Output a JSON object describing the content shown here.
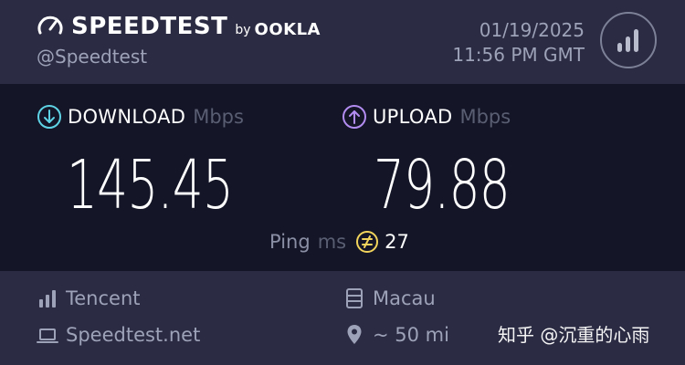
{
  "header": {
    "brand": "SPEEDTEST",
    "by": "by",
    "provider": "OOKLA",
    "handle": "@Speedtest",
    "date": "01/19/2025",
    "time": "11:56 PM GMT"
  },
  "results": {
    "download": {
      "label": "DOWNLOAD",
      "unit": "Mbps",
      "value": "145.45"
    },
    "upload": {
      "label": "UPLOAD",
      "unit": "Mbps",
      "value": "79.88"
    },
    "ping": {
      "label": "Ping",
      "unit": "ms",
      "value": "27"
    }
  },
  "server": {
    "isp": "Tencent",
    "site": "Speedtest.net",
    "location": "Macau",
    "distance": "~ 50 mi"
  },
  "watermark": "知乎 @沉重的心雨",
  "colors": {
    "download_accent": "#5fd3e6",
    "upload_accent": "#b28cf0",
    "ping_accent": "#f2d45c",
    "header_bg": "#2b2b43",
    "main_bg": "#141526"
  },
  "icons": {
    "logo": "gauge-icon",
    "badge": "signal-bars-icon",
    "download": "download-arrow-icon",
    "upload": "upload-arrow-icon",
    "ping": "ping-icon",
    "isp": "signal-icon",
    "site": "laptop-icon",
    "location": "server-icon",
    "distance": "location-pin-icon"
  }
}
